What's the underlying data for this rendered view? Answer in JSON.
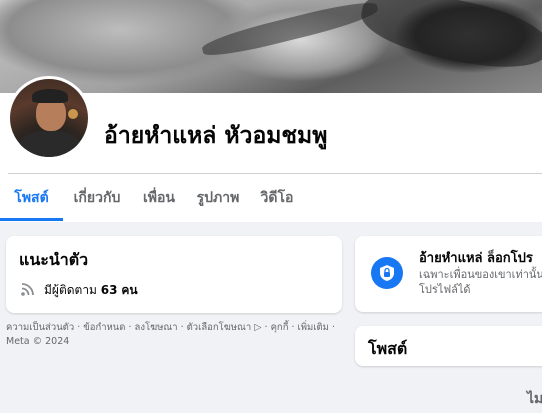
{
  "profile": {
    "name": "อ้ายหำแหล่ หัวอมชมพู"
  },
  "tabs": [
    {
      "label": "โพสต์",
      "active": true
    },
    {
      "label": "เกี่ยวกับ",
      "active": false
    },
    {
      "label": "เพื่อน",
      "active": false
    },
    {
      "label": "รูปภาพ",
      "active": false
    },
    {
      "label": "วิดีโอ",
      "active": false
    }
  ],
  "intro": {
    "title": "แนะนำตัว",
    "followers_prefix": "มีผู้ติดตาม",
    "followers_count": "63",
    "followers_unit": "คน"
  },
  "footer": {
    "links": "ความเป็นส่วนตัว · ข้อกำหนด · ลงโฆษณา · ตัวเลือกโฆษณา ▷ · คุกกี้ · เพิ่มเติม ·",
    "copyright": "Meta © 2024"
  },
  "locked": {
    "title": "อ้ายหำแหล่ ล็อกโปร",
    "description": "เฉพาะเพื่อนของเขาเท่านั้น โปรไฟล์ได้"
  },
  "posts": {
    "title": "โพสต์"
  },
  "trailing": "ไม",
  "colors": {
    "accent": "#1877f2",
    "background": "#f0f2f5",
    "secondary_text": "#65676b"
  },
  "icons": {
    "followers": "rss-icon",
    "locked": "shield-lock-icon"
  }
}
